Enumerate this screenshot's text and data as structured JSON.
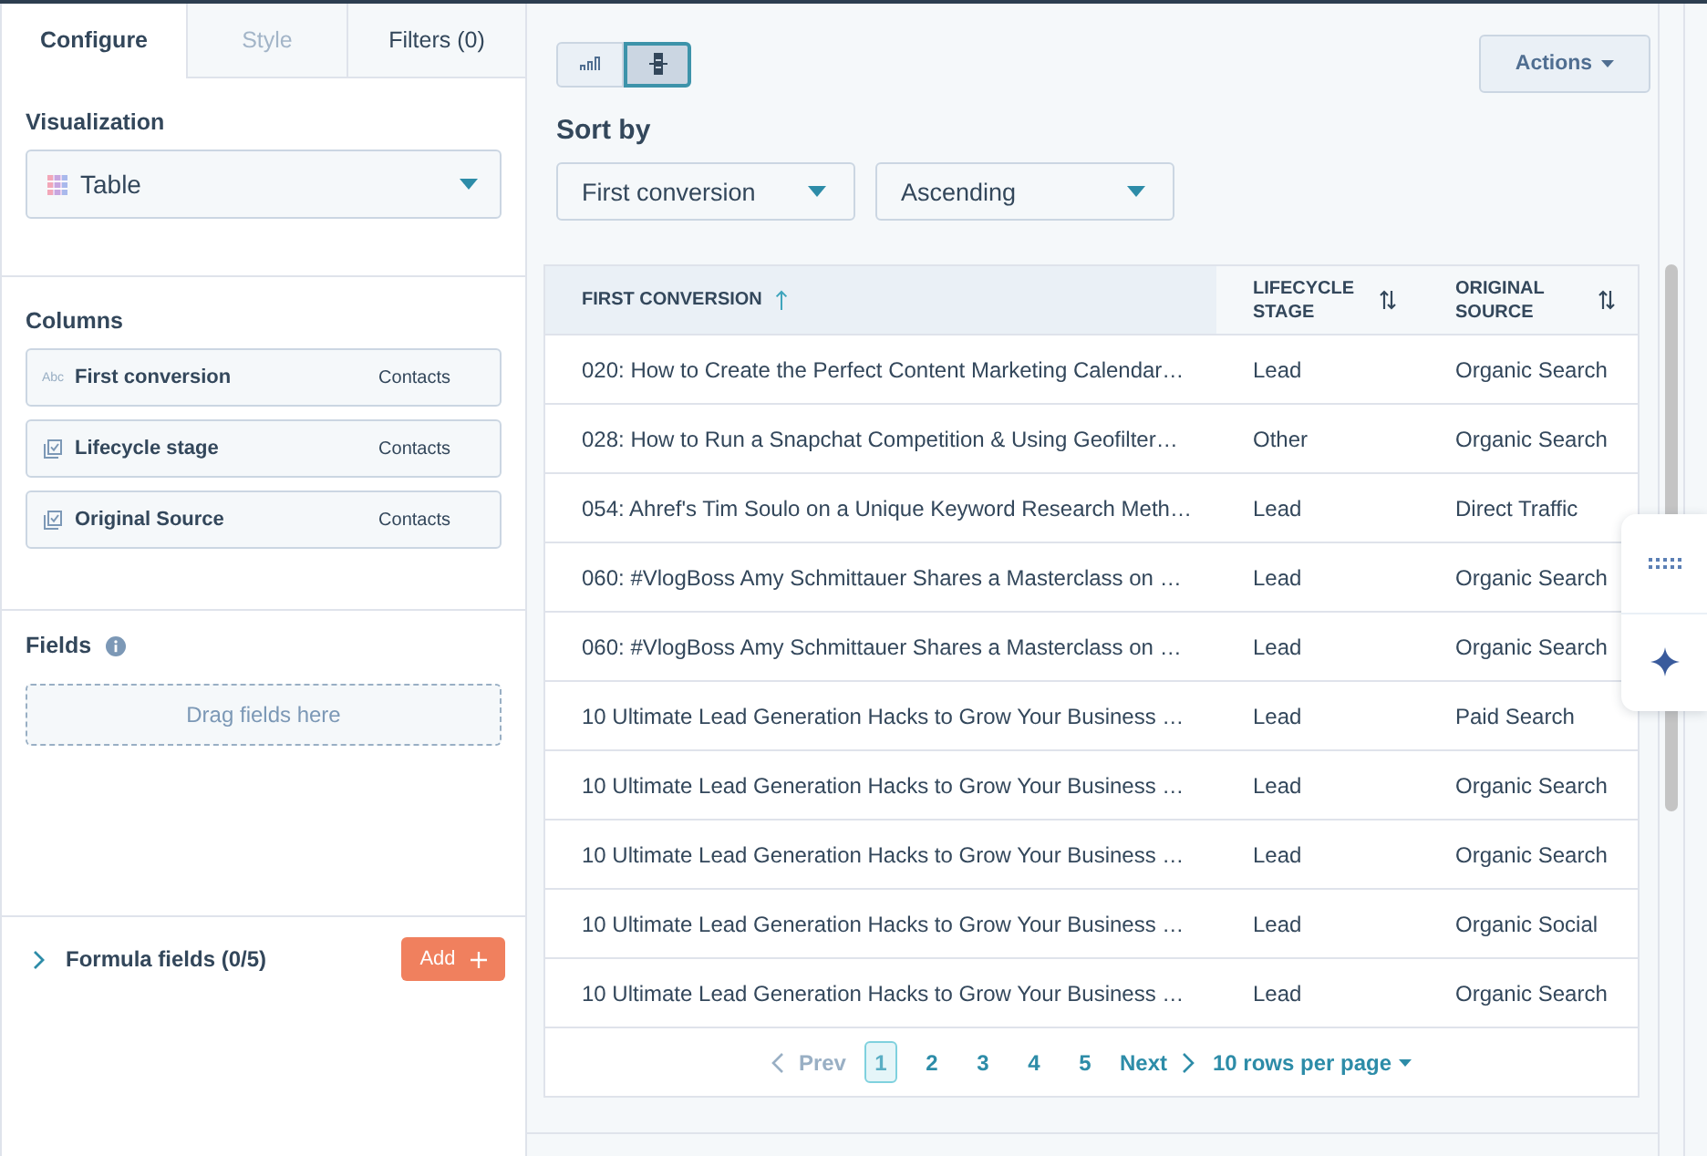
{
  "left_panel": {
    "tabs": [
      {
        "label": "Configure",
        "selected": true,
        "disabled": false
      },
      {
        "label": "Style",
        "selected": false,
        "disabled": true
      },
      {
        "label": "Filters (0)",
        "selected": false,
        "disabled": false
      }
    ],
    "visualization": {
      "label": "Visualization",
      "value": "Table"
    },
    "columns": {
      "label": "Columns",
      "items": [
        {
          "kind": "text",
          "type_label": "Abc",
          "name": "First conversion",
          "source": "Contacts"
        },
        {
          "kind": "enumeration",
          "name": "Lifecycle stage",
          "source": "Contacts"
        },
        {
          "kind": "enumeration",
          "name": "Original Source",
          "source": "Contacts"
        }
      ]
    },
    "fields": {
      "label": "Fields",
      "drop_hint": "Drag fields here"
    },
    "formula_fields": {
      "label": "Formula fields (0/5)",
      "expanded": false,
      "add_button": "Add"
    }
  },
  "main": {
    "view_toggle": [
      {
        "kind": "chart",
        "selected": false
      },
      {
        "kind": "table",
        "selected": true
      }
    ],
    "actions_button": "Actions",
    "sort": {
      "label": "Sort by",
      "field": "First conversion",
      "direction": "Ascending"
    },
    "table": {
      "columns": [
        {
          "label": "FIRST CONVERSION",
          "sorted": true
        },
        {
          "label": "LIFECYCLE STAGE",
          "sorted": false
        },
        {
          "label": "ORIGINAL SOURCE",
          "sorted": false
        }
      ],
      "rows": [
        [
          "020: How to Create the Perfect Content Marketing Calendar…",
          "Lead",
          "Organic Search"
        ],
        [
          "028: How to Run a Snapchat Competition & Using Geofilter…",
          "Other",
          "Organic Search"
        ],
        [
          "054: Ahref's Tim Soulo on a Unique Keyword Research Meth…",
          "Lead",
          "Direct Traffic"
        ],
        [
          "060: #VlogBoss Amy Schmittauer Shares a Masterclass on …",
          "Lead",
          "Organic Search"
        ],
        [
          "060: #VlogBoss Amy Schmittauer Shares a Masterclass on …",
          "Lead",
          "Organic Search"
        ],
        [
          "10 Ultimate Lead Generation Hacks to Grow Your Business …",
          "Lead",
          "Paid Search"
        ],
        [
          "10 Ultimate Lead Generation Hacks to Grow Your Business …",
          "Lead",
          "Organic Search"
        ],
        [
          "10 Ultimate Lead Generation Hacks to Grow Your Business …",
          "Lead",
          "Organic Search"
        ],
        [
          "10 Ultimate Lead Generation Hacks to Grow Your Business …",
          "Lead",
          "Organic Social"
        ],
        [
          "10 Ultimate Lead Generation Hacks to Grow Your Business …",
          "Lead",
          "Organic Search"
        ]
      ]
    },
    "pagination": {
      "prev": {
        "label": "Prev",
        "disabled": true
      },
      "pages": [
        {
          "label": "1",
          "selected": true
        },
        {
          "label": "2",
          "selected": false
        },
        {
          "label": "3",
          "selected": false
        },
        {
          "label": "4",
          "selected": false
        },
        {
          "label": "5",
          "selected": false
        }
      ],
      "next": {
        "label": "Next",
        "disabled": false
      },
      "rows_per_page": "10 rows per page"
    }
  }
}
